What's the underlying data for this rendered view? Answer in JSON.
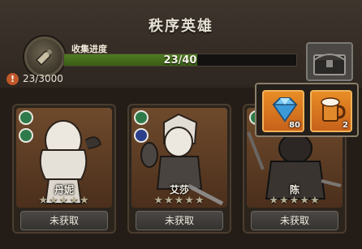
{
  "header": {
    "title": "秩序英雄",
    "collection_label": "收集进度",
    "collection_progress_text": "23/40",
    "collection_progress": 0.575,
    "points_text": "23/3000",
    "points_icon": "alert-icon"
  },
  "heroes": [
    {
      "name": "丹妮",
      "stars_total": 5,
      "stars_filled": 0,
      "status": "未获取",
      "badges": [
        "tree-icon",
        "sprout-icon"
      ]
    },
    {
      "name": "艾莎",
      "stars_total": 5,
      "stars_filled": 0,
      "status": "未获取",
      "badges": [
        "tree-icon",
        "shield-icon"
      ]
    },
    {
      "name": "陈",
      "stars_total": 5,
      "stars_filled": 0,
      "status": "未获取",
      "badges": [
        "tree-icon",
        "shield-icon"
      ]
    }
  ],
  "reward_popup": {
    "items": [
      {
        "icon": "diamond-icon",
        "qty": "80"
      },
      {
        "icon": "beer-mug-icon",
        "qty": "2"
      }
    ]
  },
  "colors": {
    "progress_fill": "#4f7a22",
    "reward_bg": "#e88d26",
    "badge_green": "#2f7a4a",
    "badge_blue": "#2b3f8a"
  }
}
